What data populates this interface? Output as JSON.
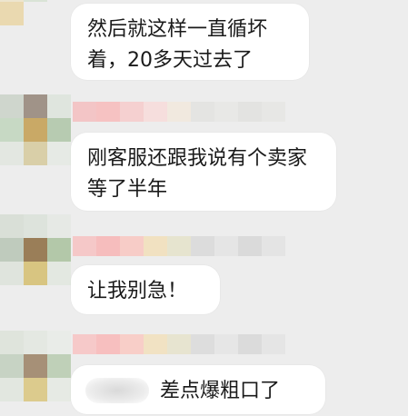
{
  "messages": [
    {
      "text": "然后就这样一直循坏着，20多天过去了"
    },
    {
      "text": "刚客服还跟我说有个卖家等了半年"
    },
    {
      "text": "让我别急！"
    },
    {
      "text": "差点爆粗口了"
    }
  ],
  "colors": {
    "background": "#ededed",
    "bubble": "#ffffff",
    "text": "#1a1a1a"
  },
  "icons": {
    "avatar": "pixelated-avatar",
    "nickname": "pixelated-name",
    "redacted": "blurred-emoji"
  }
}
